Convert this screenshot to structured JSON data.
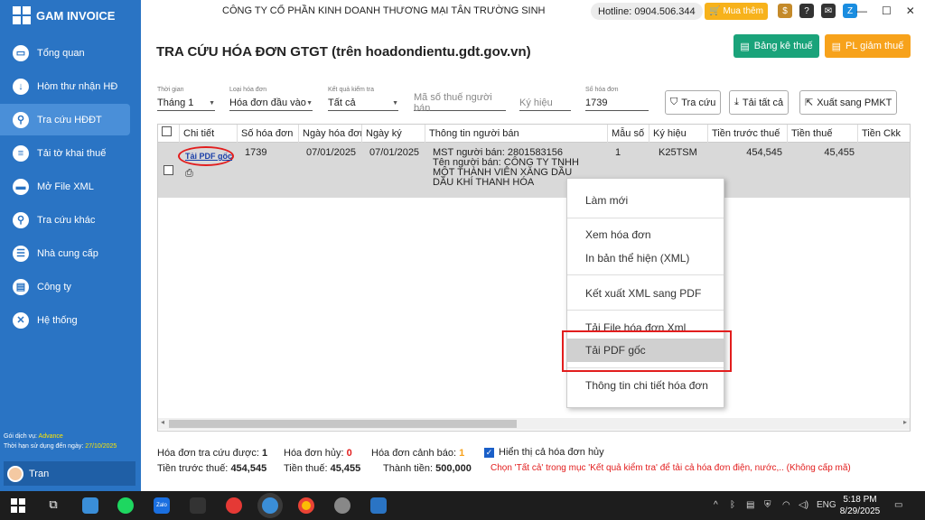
{
  "app": {
    "name": "GAM INVOICE",
    "company": "CÔNG TY CỔ PHẦN KINH DOANH THƯƠNG MẠI TÂN TRƯỜNG SINH",
    "hotline": "Hotline: 0904.506.344",
    "buy_label": "Mua thêm"
  },
  "sidebar": {
    "items": [
      {
        "label": "Tổng quan",
        "icon": "monitor-icon"
      },
      {
        "label": "Hòm thư nhận HĐ",
        "icon": "download-icon"
      },
      {
        "label": "Tra cứu HĐĐT",
        "icon": "search-doc-icon"
      },
      {
        "label": "Tải tờ khai thuế",
        "icon": "tax-form-icon"
      },
      {
        "label": "Mở File XML",
        "icon": "folder-icon"
      },
      {
        "label": "Tra cứu khác",
        "icon": "search-icon"
      },
      {
        "label": "Nhà cung cấp",
        "icon": "contact-icon"
      },
      {
        "label": "Công ty",
        "icon": "document-icon"
      },
      {
        "label": "Hệ thống",
        "icon": "tools-icon"
      }
    ],
    "plan_label": "Gói dịch vụ:",
    "plan_value": "Advance",
    "expiry_label": "Thời hạn sử dụng đến ngày:",
    "expiry_value": "27/10/2025",
    "user": "Tran"
  },
  "header": {
    "title": "TRA CỨU HÓA ĐƠN GTGT (trên hoadondientu.gdt.gov.vn)",
    "btn_tax": "Bảng kê thuế",
    "btn_pl": "PL giảm thuế"
  },
  "filters": {
    "period": {
      "label": "Thời gian",
      "value": "Tháng 1"
    },
    "type": {
      "label": "Loại hóa đơn",
      "value": "Hóa đơn đầu vào"
    },
    "result": {
      "label": "Kết quả kiểm tra",
      "value": "Tất cả"
    },
    "tax_placeholder": "Mã số thuế người bán",
    "symbol_placeholder": "Ký hiệu",
    "number": {
      "label": "Số hóa đơn",
      "value": "1739"
    }
  },
  "toolbar": {
    "search": "Tra cứu",
    "download_all": "Tải tất cả",
    "export": "Xuất sang PMKT"
  },
  "table": {
    "columns": [
      "Chi tiết",
      "Số hóa đơn",
      "Ngày hóa đơn",
      "Ngày ký",
      "Thông tin người bán",
      "Mẫu số",
      "Ký hiệu",
      "Tiền trước thuế",
      "Tiền thuế",
      "Tiền Ckk"
    ],
    "row": {
      "link": "Tải PDF gốc",
      "number": "1739",
      "date": "07/01/2025",
      "sign_date": "07/01/2025",
      "seller_tax": "MST người bán: 2801583156",
      "seller_name": "Tên người bán: CÔNG TY TNHH MỘT THÀNH VIÊN XĂNG DẦU DẦU KHÍ THANH HÓA",
      "form": "1",
      "symbol": "K25TSM",
      "pre_tax": "454,545",
      "tax": "45,455"
    }
  },
  "context_menu": [
    "Làm mới",
    "Xem hóa đơn",
    "In bản thể hiện (XML)",
    "Kết xuất XML sang PDF",
    "Tải File hóa đơn Xml",
    "Tải PDF gốc",
    "Thông tin chi tiết hóa đơn"
  ],
  "footer": {
    "found_label": "Hóa đơn tra cứu được:",
    "found": "1",
    "cancel_label": "Hóa đơn hủy:",
    "cancel": "0",
    "warn_label": "Hóa đơn cảnh báo:",
    "warn": "1",
    "show_cancel": "Hiển thị cả hóa đơn hủy",
    "pretax_label": "Tiền trước thuế:",
    "pretax": "454,545",
    "tax_label": "Tiền thuế:",
    "tax": "45,455",
    "total_label": "Thành tiền:",
    "total": "500,000",
    "note": "Chọn 'Tất cả' trong mục 'Kết quả kiểm tra' để tải cả hóa đơn điện, nước,.. (Không cấp mã)",
    "colors": {
      "cancel": "#e21d1d",
      "warn": "#f7a21b",
      "note": "#e21d1d"
    }
  },
  "taskbar": {
    "time": "5:18 PM",
    "date": "8/29/2025",
    "lang": "ENG"
  }
}
